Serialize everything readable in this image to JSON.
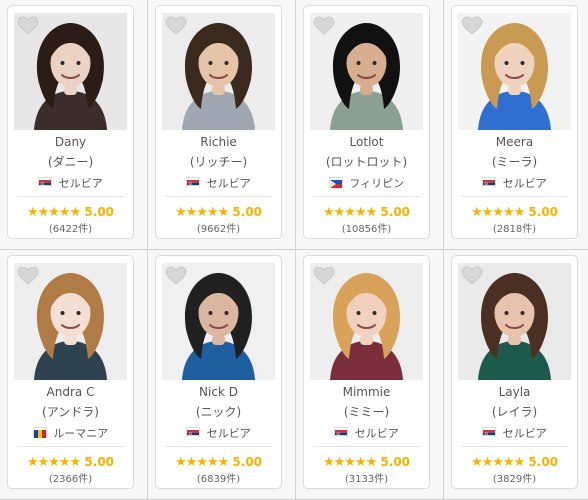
{
  "teachers": [
    {
      "name": "Dany",
      "kana": "(ダニー)",
      "country": "セルビア",
      "flag": "serbia",
      "stars": "★★★★★",
      "rating": "5.00",
      "count": "(6422件)",
      "bg": "#e7e7e7",
      "hair": "#2b1c16",
      "skin": "#ead3c3",
      "shirt": "#3b2e2a"
    },
    {
      "name": "Richie",
      "kana": "(リッチー)",
      "country": "セルビア",
      "flag": "serbia",
      "stars": "★★★★★",
      "rating": "5.00",
      "count": "(9662件)",
      "bg": "#ececec",
      "hair": "#3a2a1e",
      "skin": "#e6c4a8",
      "shirt": "#9fa7b3"
    },
    {
      "name": "Lotlot",
      "kana": "(ロットロット)",
      "country": "フィリピン",
      "flag": "philippines",
      "stars": "★★★★★",
      "rating": "5.00",
      "count": "(10856件)",
      "bg": "#efefef",
      "hair": "#111111",
      "skin": "#d7ae8f",
      "shirt": "#8aa090"
    },
    {
      "name": "Meera",
      "kana": "(ミーラ)",
      "country": "セルビア",
      "flag": "serbia",
      "stars": "★★★★★",
      "rating": "5.00",
      "count": "(2818件)",
      "bg": "#f2f2f2",
      "hair": "#c89a52",
      "skin": "#f0d3bf",
      "shirt": "#2f6fd0"
    },
    {
      "name": "Andra C",
      "kana": "(アンドラ)",
      "country": "ルーマニア",
      "flag": "romania",
      "stars": "★★★★★",
      "rating": "5.00",
      "count": "(2366件)",
      "bg": "#eeeeee",
      "hair": "#b07b45",
      "skin": "#f3dfd3",
      "shirt": "#2e4250"
    },
    {
      "name": "Nick D",
      "kana": "(ニック)",
      "country": "セルビア",
      "flag": "serbia",
      "stars": "★★★★★",
      "rating": "5.00",
      "count": "(6839件)",
      "bg": "#f0f0f0",
      "hair": "#202020",
      "skin": "#dcb7a0",
      "shirt": "#1f5f9f"
    },
    {
      "name": "Mimmie",
      "kana": "(ミミー)",
      "country": "セルビア",
      "flag": "serbia",
      "stars": "★★★★★",
      "rating": "5.00",
      "count": "(3133件)",
      "bg": "#eeeeee",
      "hair": "#d9a25a",
      "skin": "#f1d1bd",
      "shirt": "#7a2d3a"
    },
    {
      "name": "Layla",
      "kana": "(レイラ)",
      "country": "セルビア",
      "flag": "serbia",
      "stars": "★★★★★",
      "rating": "5.00",
      "count": "(3829件)",
      "bg": "#eaeaea",
      "hair": "#4a2f22",
      "skin": "#e8c3ad",
      "shirt": "#1c5a4b"
    }
  ]
}
